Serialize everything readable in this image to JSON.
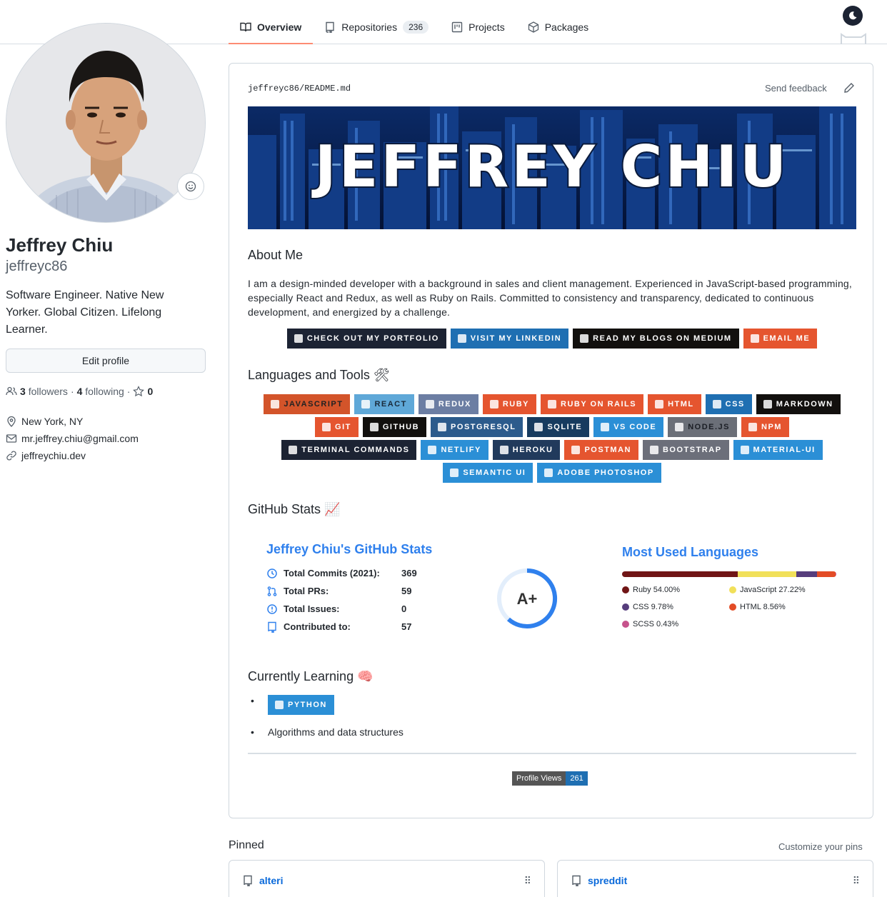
{
  "nav": {
    "tabs": [
      {
        "label": "Overview",
        "icon": "book-icon"
      },
      {
        "label": "Repositories",
        "icon": "repo-icon",
        "count": "236"
      },
      {
        "label": "Projects",
        "icon": "project-icon"
      },
      {
        "label": "Packages",
        "icon": "package-icon"
      }
    ]
  },
  "profile": {
    "name": "Jeffrey Chiu",
    "login": "jeffreyc86",
    "bio": "Software Engineer. Native New Yorker. Global Citizen. Lifelong Learner.",
    "edit_label": "Edit profile",
    "followers_count": "3",
    "followers_label": "followers",
    "following_count": "4",
    "following_label": "following",
    "stars_count": "0",
    "location": "New York, NY",
    "email": "mr.jeffrey.chiu@gmail.com",
    "website": "jeffreychiu.dev"
  },
  "readme": {
    "owner": "jeffreyc86",
    "sep": "/",
    "file": "README.md",
    "feedback": "Send feedback",
    "banner_text": "JEFFREY CHIU",
    "about_title": "About Me",
    "about_text": "I am a design-minded developer with a background in sales and client management. Experienced in JavaScript-based programming, especially React and Redux, as well as Ruby on Rails. Committed to consistency and transparency, dedicated to continuous development, and energized by a challenge.",
    "link_badges": [
      {
        "label": "CHECK OUT MY PORTFOLIO",
        "color": "#1c2333"
      },
      {
        "label": "VISIT MY LINKEDIN",
        "color": "#1f6fb2"
      },
      {
        "label": "READ MY BLOGS ON MEDIUM",
        "color": "#12100e"
      },
      {
        "label": "EMAIL ME",
        "color": "#e5552f"
      }
    ],
    "tools_title": "Languages and Tools 🛠",
    "tools_rows": [
      [
        {
          "label": "JAVASCRIPT",
          "color": "#d3542a",
          "text": "#222"
        },
        {
          "label": "REACT",
          "color": "#5fa8d8",
          "text": "#1a2a3a"
        },
        {
          "label": "REDUX",
          "color": "#6c7ea3",
          "text": "#fff"
        },
        {
          "label": "RUBY",
          "color": "#e5552f",
          "text": "#fff"
        },
        {
          "label": "RUBY ON RAILS",
          "color": "#e5552f",
          "text": "#fff"
        },
        {
          "label": "HTML",
          "color": "#e5552f",
          "text": "#fff"
        },
        {
          "label": "CSS",
          "color": "#1f6fb2",
          "text": "#fff"
        },
        {
          "label": "MARKDOWN",
          "color": "#12100e",
          "text": "#fff"
        }
      ],
      [
        {
          "label": "GIT",
          "color": "#e5552f",
          "text": "#fff"
        },
        {
          "label": "GITHUB",
          "color": "#12100e",
          "text": "#fff"
        },
        {
          "label": "POSTGRESQL",
          "color": "#2c5b8c",
          "text": "#fff"
        },
        {
          "label": "SQLITE",
          "color": "#173b5f",
          "text": "#fff"
        },
        {
          "label": "VS CODE",
          "color": "#2b8fd6",
          "text": "#fff"
        },
        {
          "label": "NODE.JS",
          "color": "#6b6f78",
          "text": "#1b1e25"
        },
        {
          "label": "NPM",
          "color": "#e5552f",
          "text": "#fff"
        }
      ],
      [
        {
          "label": "TERMINAL COMMANDS",
          "color": "#1c2333",
          "text": "#fff"
        },
        {
          "label": "NETLIFY",
          "color": "#2b8fd6",
          "text": "#fff"
        },
        {
          "label": "HEROKU",
          "color": "#213a5c",
          "text": "#fff"
        },
        {
          "label": "POSTMAN",
          "color": "#e5552f",
          "text": "#fff"
        },
        {
          "label": "BOOTSTRAP",
          "color": "#6c6f7a",
          "text": "#fff"
        },
        {
          "label": "MATERIAL-UI",
          "color": "#2b8fd6",
          "text": "#fff"
        }
      ],
      [
        {
          "label": "SEMANTIC UI",
          "color": "#2b8fd6",
          "text": "#fff"
        },
        {
          "label": "ADOBE PHOTOSHOP",
          "color": "#2b8fd6",
          "text": "#fff"
        }
      ]
    ],
    "stats_title": "GitHub Stats 📈",
    "stats_card": {
      "title": "Jeffrey Chiu's GitHub Stats",
      "rows": [
        {
          "label": "Total Commits (2021):",
          "value": "369",
          "icon": "clock-icon"
        },
        {
          "label": "Total PRs:",
          "value": "59",
          "icon": "pull-request-icon"
        },
        {
          "label": "Total Issues:",
          "value": "0",
          "icon": "issue-icon"
        },
        {
          "label": "Contributed to:",
          "value": "57",
          "icon": "repo-icon"
        }
      ],
      "grade": "A+"
    },
    "languages_card": {
      "title": "Most Used Languages",
      "items": [
        {
          "label": "Ruby 54.00%",
          "percent": 54.0,
          "color": "#701516"
        },
        {
          "label": "JavaScript 27.22%",
          "percent": 27.22,
          "color": "#f1e05a"
        },
        {
          "label": "CSS 9.78%",
          "percent": 9.78,
          "color": "#563d7c"
        },
        {
          "label": "HTML 8.56%",
          "percent": 8.56,
          "color": "#e34c26"
        },
        {
          "label": "SCSS 0.43%",
          "percent": 0.43,
          "color": "#c6538c"
        }
      ]
    },
    "learning_title": "Currently Learning 🧠",
    "learning_badge": "PYTHON",
    "learning_item": "Algorithms and data structures",
    "views_label": "Profile Views",
    "views_count": "261"
  },
  "pinned": {
    "title": "Pinned",
    "customize": "Customize your pins",
    "repos": [
      "alteri",
      "spreddit"
    ]
  }
}
